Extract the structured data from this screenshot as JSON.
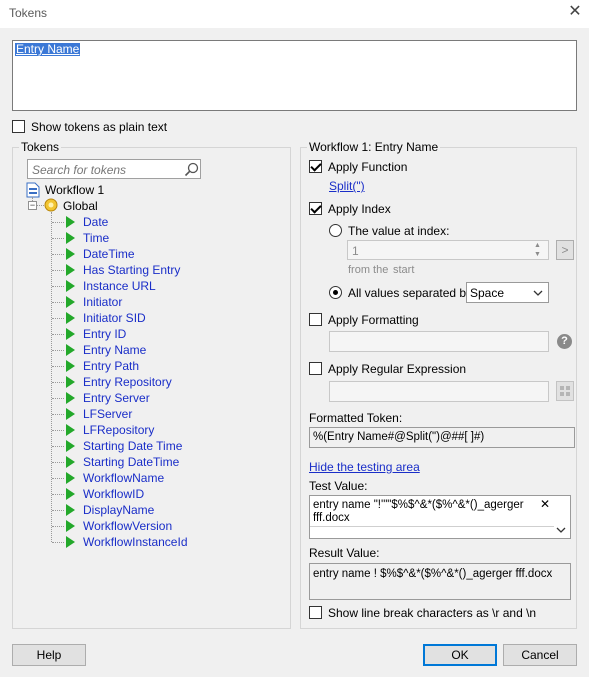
{
  "window": {
    "title": "Tokens",
    "close_glyph": "✕"
  },
  "token_box": {
    "value": "Entry Name"
  },
  "show_plain": {
    "label": "Show tokens as plain text",
    "checked": false
  },
  "tokens_panel": {
    "legend": "Tokens",
    "search_placeholder": "Search for tokens",
    "root": "Workflow 1",
    "global": "Global",
    "items": [
      "Date",
      "Time",
      "DateTime",
      "Has Starting Entry",
      "Instance URL",
      "Initiator",
      "Initiator SID",
      "Entry ID",
      "Entry Name",
      "Entry Path",
      "Entry Repository",
      "Entry Server",
      "LFServer",
      "LFRepository",
      "Starting Date Time",
      "Starting DateTime",
      "WorkflowName",
      "WorkflowID",
      "DisplayName",
      "WorkflowVersion",
      "WorkflowInstanceId"
    ]
  },
  "right_panel": {
    "legend": "Workflow 1: Entry Name",
    "apply_function": {
      "label": "Apply Function",
      "checked": true,
      "link": "Split(\")"
    },
    "apply_index": {
      "label": "Apply Index",
      "checked": true
    },
    "value_at_index": {
      "label": "The value at index:",
      "selected": false,
      "value": "1",
      "go": ">",
      "from_label": "from the",
      "start_label": "start"
    },
    "all_values": {
      "label": "All values separated by:",
      "selected": true,
      "separator": "Space"
    },
    "apply_formatting": {
      "label": "Apply Formatting",
      "checked": false,
      "help": "?"
    },
    "apply_regex": {
      "label": "Apply Regular Expression",
      "checked": false
    },
    "formatted_token": {
      "label": "Formatted Token:",
      "value": "%(Entry Name#@Split(\")@##[ ]#)"
    },
    "hide_testing": "Hide the testing area",
    "test_value": {
      "label": "Test Value:",
      "line1": "entry name \"!'\"\"$%$^&*($%^&*()_agerger",
      "line2": "fff.docx",
      "clear": "✕"
    },
    "result_value": {
      "label": "Result Value:",
      "value": "entry name  !  $%$^&*($%^&*()_agerger fff.docx"
    },
    "show_line_breaks": {
      "label": "Show line break characters as \\r and \\n",
      "checked": false
    }
  },
  "buttons": {
    "help": "Help",
    "ok": "OK",
    "cancel": "Cancel"
  }
}
